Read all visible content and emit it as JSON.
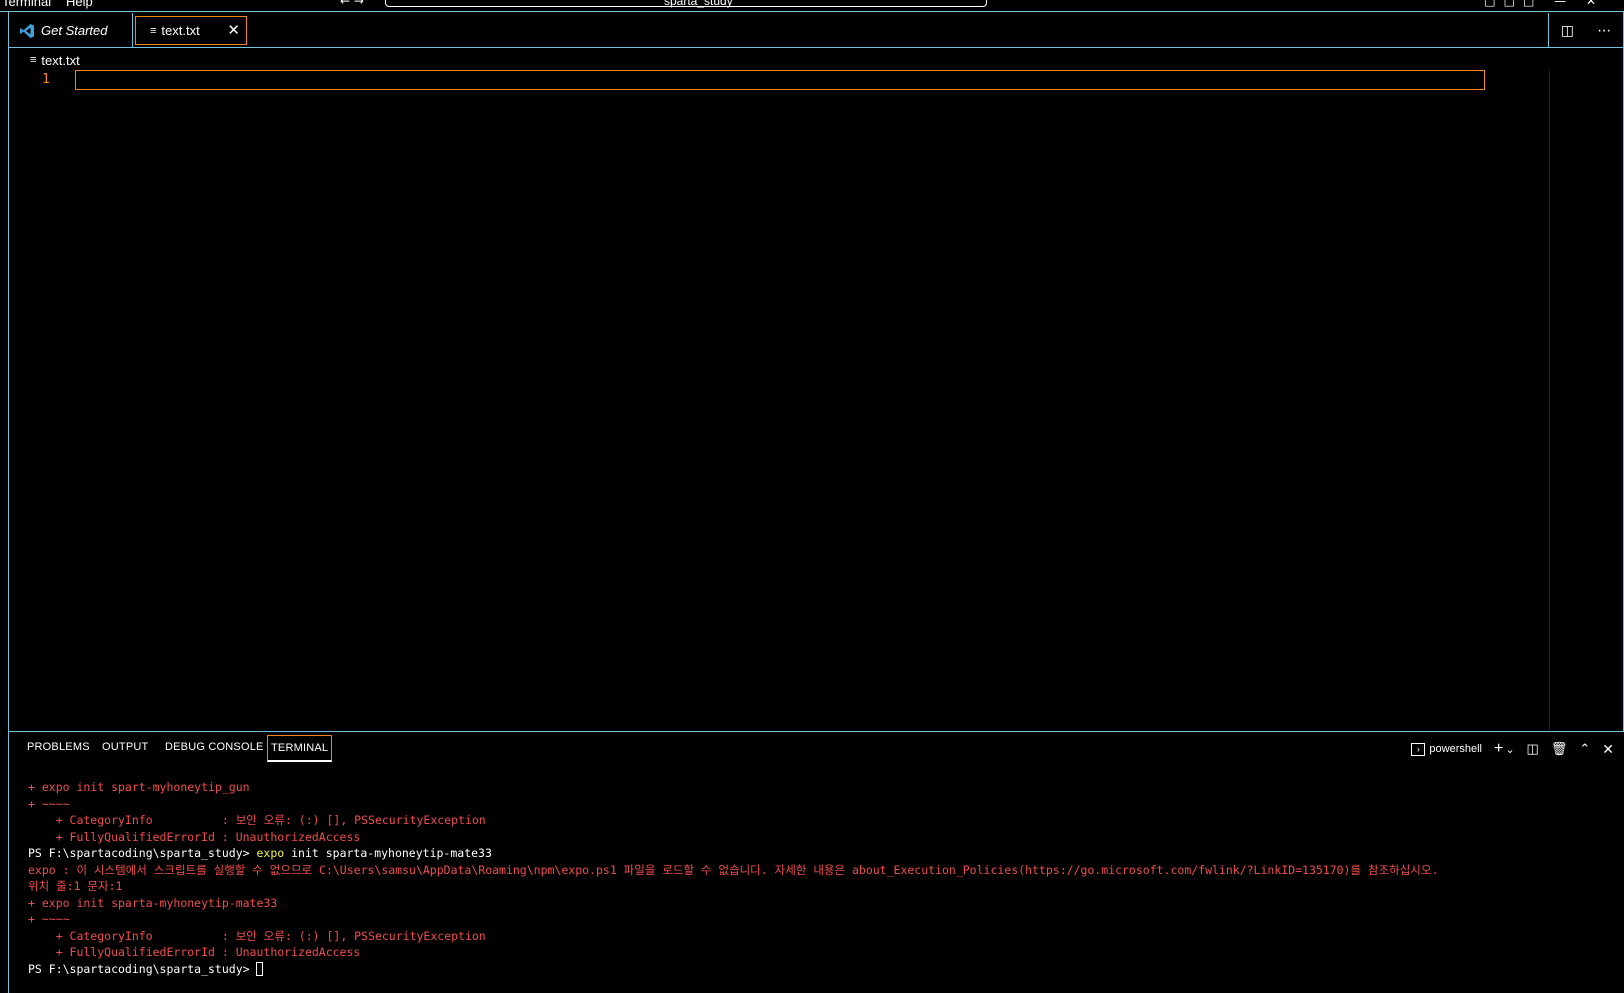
{
  "menubar": {
    "items": [
      "Terminal",
      "Help"
    ],
    "command_center": "sparta_study"
  },
  "tabs": [
    {
      "label": "Get Started"
    },
    {
      "label": "text.txt",
      "active": true
    }
  ],
  "breadcrumb": {
    "file": "text.txt"
  },
  "editor": {
    "line_numbers": [
      "1"
    ]
  },
  "panel": {
    "tabs": [
      "PROBLEMS",
      "OUTPUT",
      "DEBUG CONSOLE",
      "TERMINAL"
    ],
    "active_tab": "TERMINAL",
    "shell": "powershell"
  },
  "terminal": {
    "l1": "+ expo init spart-myhoneytip_gun",
    "l2": "+ ~~~~",
    "l3": "    + CategoryInfo          : 보안 오류: (:) [], PSSecurityException",
    "l4": "    + FullyQualifiedErrorId : UnauthorizedAccess",
    "l5_prompt": "PS F:\\spartacoding\\sparta_study> ",
    "l5_cmd": "expo",
    "l5_args": " init sparta-myhoneytip-mate33",
    "l6": "expo : 이 시스템에서 스크립트를 실행할 수 없으므로 C:\\Users\\samsu\\AppData\\Roaming\\npm\\expo.ps1 파일을 로드할 수 없습니다. 자세한 내용은 about_Execution_Policies(https://go.microsoft.com/fwlink/?LinkID=135170)를 참조하십시오.",
    "l7": "위치 줄:1 문자:1",
    "l8": "+ expo init sparta-myhoneytip-mate33",
    "l9": "+ ~~~~",
    "l10": "    + CategoryInfo          : 보안 오류: (:) [], PSSecurityException",
    "l11": "    + FullyQualifiedErrorId : UnauthorizedAccess",
    "l12_prompt": "PS F:\\spartacoding\\sparta_study> "
  },
  "colors": {
    "focus_border": "#f38518",
    "contrast_border": "#6fc3df",
    "error_text": "#f14c4c",
    "command_highlight": "#f5f543"
  },
  "icons": [
    "vscode-logo-icon",
    "file-lines-icon",
    "close-icon",
    "split-editor-icon",
    "more-actions-icon",
    "terminal-icon",
    "plus-icon",
    "chevron-down-icon",
    "split-terminal-icon",
    "trash-icon",
    "chevron-up-icon",
    "close-panel-icon"
  ]
}
